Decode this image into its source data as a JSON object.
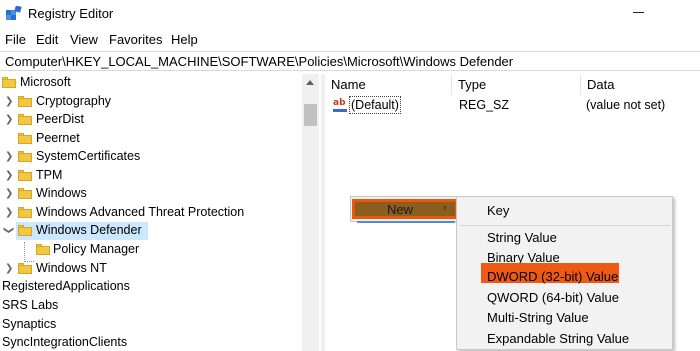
{
  "window": {
    "title": "Registry Editor"
  },
  "menu": [
    "File",
    "Edit",
    "View",
    "Favorites",
    "Help"
  ],
  "address": "Computer\\HKEY_LOCAL_MACHINE\\SOFTWARE\\Policies\\Microsoft\\Windows Defender",
  "tree": [
    {
      "label": "Microsoft",
      "expanded": true
    },
    {
      "label": "Cryptography"
    },
    {
      "label": "PeerDist"
    },
    {
      "label": "Peernet"
    },
    {
      "label": "SystemCertificates"
    },
    {
      "label": "TPM"
    },
    {
      "label": "Windows"
    },
    {
      "label": "Windows Advanced Threat Protection"
    },
    {
      "label": "Windows Defender",
      "selected": true,
      "expanded": true
    },
    {
      "label": "Policy Manager"
    },
    {
      "label": "Windows NT"
    },
    {
      "label": "RegisteredApplications"
    },
    {
      "label": "SRS Labs"
    },
    {
      "label": "Synaptics"
    },
    {
      "label": "SyncIntegrationClients"
    }
  ],
  "columns": {
    "name": "Name",
    "type": "Type",
    "data": "Data"
  },
  "values": [
    {
      "name": "(Default)",
      "type": "REG_SZ",
      "data": "(value not set)",
      "icon": "string-value-icon"
    }
  ],
  "context_menu": {
    "new_label": "New",
    "arrow": "›"
  },
  "new_submenu": [
    "Key",
    "String Value",
    "Binary Value",
    "DWORD (32-bit) Value",
    "QWORD (64-bit) Value",
    "Multi-String Value",
    "Expandable String Value"
  ],
  "colors": {
    "highlight": "#ee5a13",
    "selection": "#cce8ff",
    "folder": "#f2c744"
  }
}
